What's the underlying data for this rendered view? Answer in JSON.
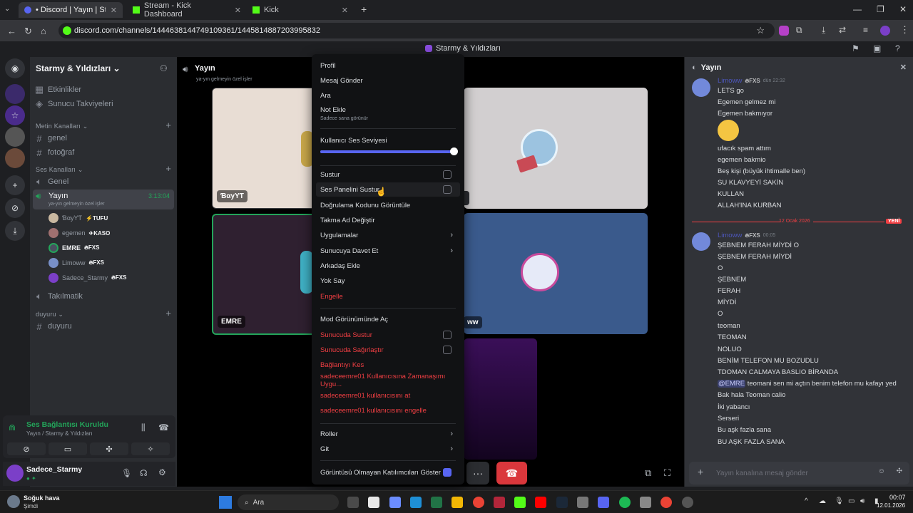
{
  "browser": {
    "tabs": [
      {
        "title": "• Discord | Yayın | Starmy & Y"
      },
      {
        "title": "Stream - Kick Dashboard"
      },
      {
        "title": "Kick"
      }
    ],
    "url": "discord.com/channels/1444638144749109361/1445814887203995832"
  },
  "discord": {
    "top_title": "Starmy & Yıldızları",
    "server_name": "Starmy & Yıldızları",
    "channels": [
      {
        "label": "Etkinlikler"
      },
      {
        "label": "Sunucu Takviyeleri"
      }
    ],
    "categories": {
      "text": "Metin Kanalları",
      "voice": "Ses Kanalları",
      "duyuru": "duyuru"
    },
    "text_channels": [
      "genel",
      "fotoğraf"
    ],
    "voice_channels": {
      "genel": "Genel",
      "yayin": "Yayın",
      "yayin_time": "3:13:04",
      "yayin_sub": "ya-yın gelmeyin özel işler",
      "takilmatik": "Takılmatik"
    },
    "voice_users": [
      {
        "name": "ƁαуYƬ",
        "tag": "TUFU"
      },
      {
        "name": "egemen",
        "tag": "KASO"
      },
      {
        "name": "EMRE",
        "tag": "FXS"
      },
      {
        "name": "Limoww",
        "tag": "FXS"
      },
      {
        "name": "Sadece_Starmy",
        "tag": "FXS"
      }
    ],
    "duyuru_channel": "duyuru",
    "voice_panel": {
      "status": "Ses Bağlantısı Kuruldu",
      "location": "Yayın / Starmy & Yıldızları"
    },
    "user": {
      "name": "Sadece_Starmy"
    }
  },
  "stage": {
    "title": "Yayın",
    "subtitle": "ya-yın gelmeyin özel işler",
    "tiles": [
      {
        "name": "ƁαуYƬ"
      },
      {
        "name": "EMRE"
      },
      {
        "name": "ww"
      }
    ]
  },
  "context_menu": {
    "profile": "Profil",
    "message": "Mesaj Gönder",
    "call": "Ara",
    "add_note": "Not Ekle",
    "add_note_sub": "Sadece sana görünür",
    "volume_label": "Kullanıcı Ses Seviyesi",
    "volume": 1.0,
    "mute": "Sustur",
    "soundboard_mute": "Ses Panelini Sustur",
    "verify_code": "Doğrulama Kodunu Görüntüle",
    "nickname": "Takma Ad Değiştir",
    "apps": "Uygulamalar",
    "invite": "Sunucuya Davet Et",
    "add_friend": "Arkadaş Ekle",
    "ignore": "Yok Say",
    "block": "Engelle",
    "mod_view": "Mod Görünümünde Aç",
    "server_mute": "Sunucuda Sustur",
    "server_deafen": "Sunucuda Sağırlaştır",
    "disconnect": "Bağlantıyı Kes",
    "timeout": "sadeceemre01 Kullanıcısına Zamanaşımı Uygu...",
    "kick": "sadeceemre01 kullanıcısını at",
    "ban": "sadeceemre01 kullanıcısını engelle",
    "roles": "Roller",
    "goto": "Git",
    "show_nonvideo": "Görüntüsü Olmayan Katılımcıları Göster"
  },
  "chat": {
    "title": "Yayın",
    "first_author": "Limoww",
    "first_author_tag": "FXS",
    "first_time": "dün 22:32",
    "messages_a": [
      "LETS go",
      "Egemen gelmez mi",
      "Egemen bakmıyor"
    ],
    "messages_b": [
      "ufacık spam attım",
      "egemen bakmio",
      "Beş kişi (büyük ihtimalle ben)",
      "SU KLAVYEYİ SAKİN",
      "KULLAN",
      "ALLAH'INA KURBAN"
    ],
    "divider_date": "12 Ocak 2026",
    "divider_new": "YENİ",
    "second_author": "Limoww",
    "second_author_tag": "FXS",
    "second_time": "00:05",
    "messages_c": [
      "ŞEBNEM FERAH MİYDİ O",
      "ŞEBNEM FERAH MİYDİ",
      "O",
      "ŞEBNEM",
      "FERAH",
      "MİYDİ",
      "O",
      "teoman",
      "TEOMAN",
      "NOLUO",
      "BENİM TELEFON MU BOZUDLU",
      "TDOMAN CALMAYA BASLIO BİRANDA"
    ],
    "mention": "@EMRE",
    "mention_rest": " teomani sen mi açtın benim telefon mu kafayı yed",
    "messages_d": [
      "Bak hala Teoman calio",
      "İki yabancı",
      "Serseri",
      "Bu aşk fazla sana",
      "BU AŞK FAZLA SANA"
    ],
    "input_placeholder": "Yayın kanalına mesaj gönder"
  },
  "taskbar": {
    "weather": "Soğuk hava",
    "weather_sub": "Şimdi",
    "search": "Ara",
    "time": "00:07",
    "date": "12.01.2026"
  },
  "colors": {
    "accent": "#5865f2",
    "danger": "#f23f43",
    "online": "#23a55a"
  }
}
